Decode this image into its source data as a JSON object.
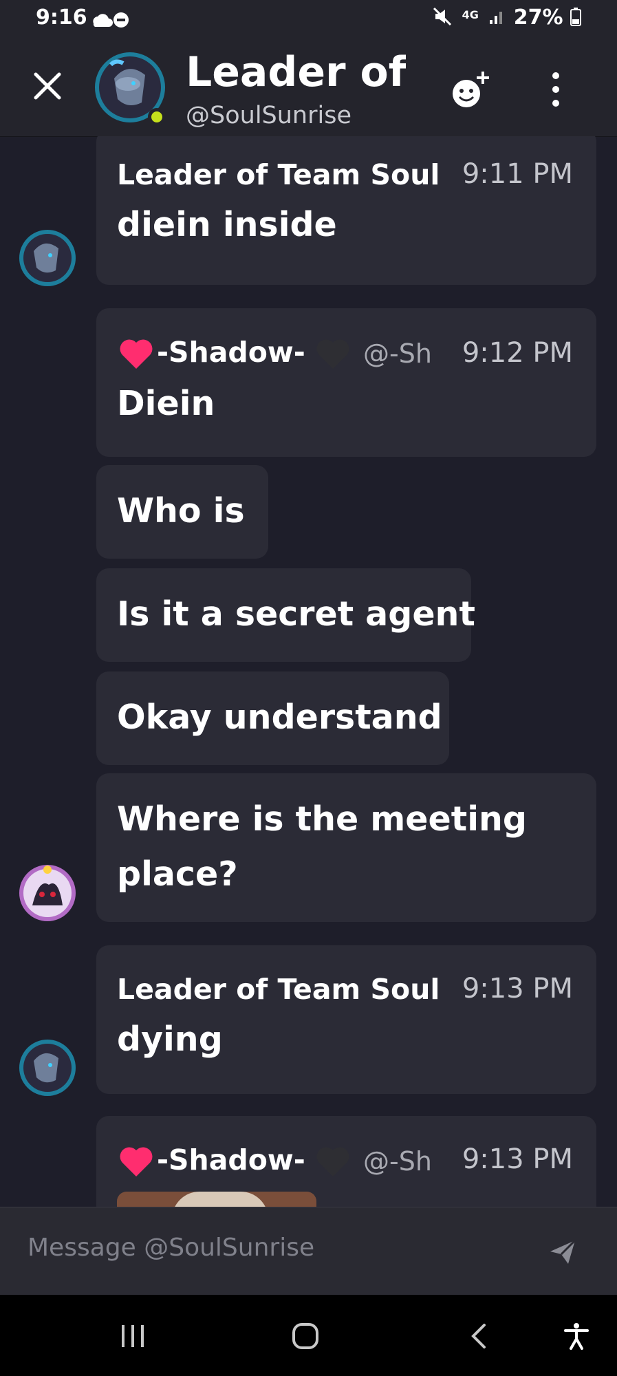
{
  "status_bar": {
    "time": "9:16",
    "network": "4G",
    "battery": "27%"
  },
  "header": {
    "title": "Leader of T",
    "subtitle": "@SoulSunrise",
    "presence_color": "#c6e11c"
  },
  "messages": [
    {
      "author": "Leader of Team Soul",
      "time": "9:11 PM",
      "text": "diein inside"
    },
    {
      "author": "-Shadow-",
      "handle": "@-Sh",
      "time": "9:12 PM",
      "texts": [
        "Diein",
        "Who is",
        "Is it a secret agent",
        "Okay understand",
        "Where is the meeting",
        "place?"
      ]
    },
    {
      "author": "Leader of Team Soul",
      "time": "9:13 PM",
      "text": "dying"
    },
    {
      "author": "-Shadow-",
      "handle": "@-Sh",
      "time": "9:13 PM"
    }
  ],
  "composer": {
    "placeholder": "Message @SoulSunrise"
  },
  "colors": {
    "background": "#1e1e2a",
    "bubble": "#2b2b36",
    "header": "#24242c",
    "accent_heart": "#ff2d6f"
  }
}
